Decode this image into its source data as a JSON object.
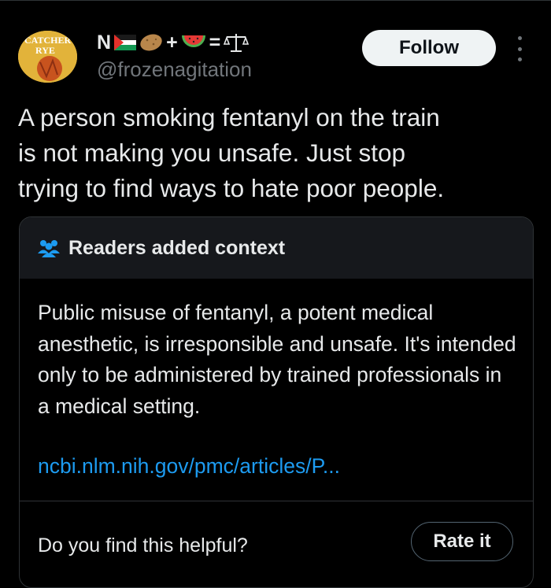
{
  "author": {
    "name_initial": "N",
    "name_symbols": [
      "+",
      "="
    ],
    "handle": "@frozenagitation",
    "avatar_text_line1": "CATCHER",
    "avatar_text_line2": "RYE",
    "name_emoji_icons": [
      "palestine-flag-icon",
      "potato-icon",
      "watermelon-icon",
      "scales-icon"
    ]
  },
  "follow_button": {
    "label": "Follow"
  },
  "tweet": {
    "text": "A person smoking fentanyl on the train\nis not making you unsafe. Just stop\ntrying to find ways to hate poor people."
  },
  "context_note": {
    "title": "Readers added context",
    "body": "Public misuse of fentanyl, a potent medical anesthetic, is irresponsible and unsafe. It's intended only to be administered by trained professionals in a medical setting.",
    "link": "ncbi.nlm.nih.gov/pmc/articles/P...",
    "helpful_prompt": "Do you find this helpful?",
    "rate_button": "Rate it"
  },
  "colors": {
    "background": "#000000",
    "text": "#e7e9ea",
    "secondary": "#71767b",
    "link": "#1d9bf0",
    "header_bg": "#16181c",
    "people_icon": "#1d9bf0"
  }
}
